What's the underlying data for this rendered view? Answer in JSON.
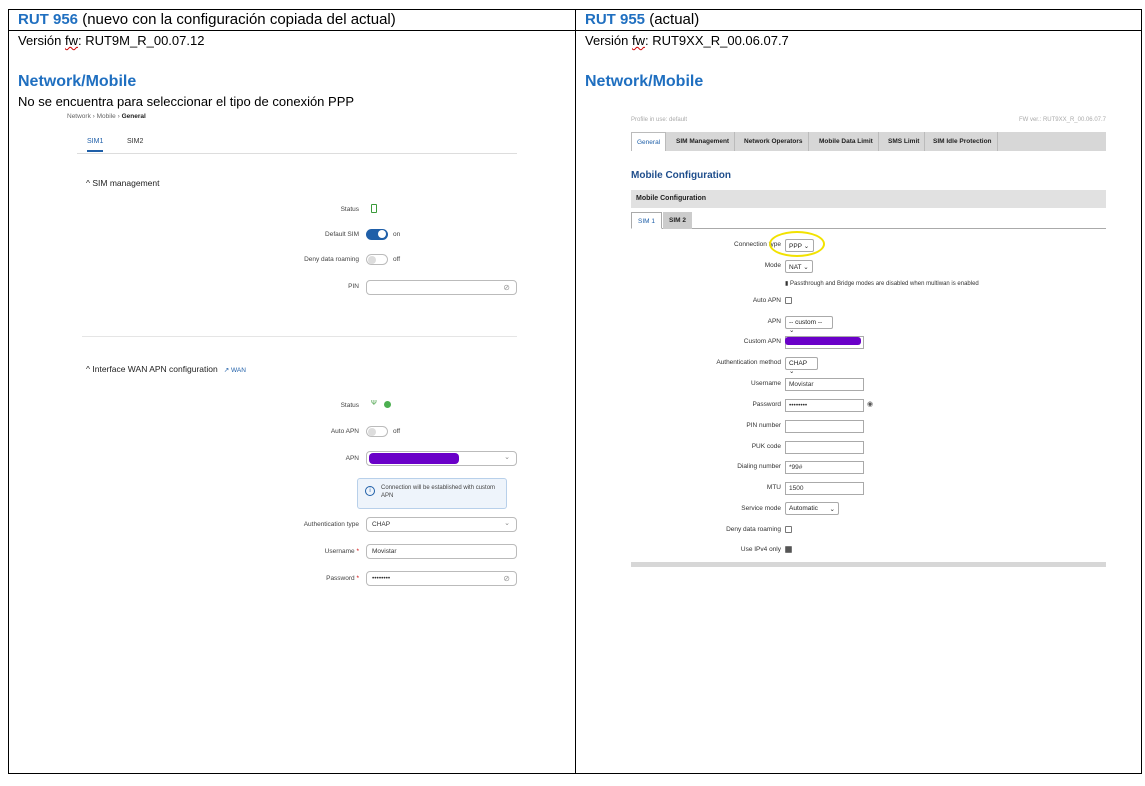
{
  "left": {
    "model": "RUT 956",
    "model_desc": " (nuevo con la configuración copiada del actual)",
    "version_prefix": "Versión ",
    "version_fw": "fw",
    "version_value": ": RUT9M_R_00.07.12",
    "section": "Network/Mobile",
    "note": "No se encuentra para seleccionar el tipo de conexión PPP",
    "shot": {
      "crumb1": "Network",
      "crumb2": "Mobile",
      "crumb3": "General",
      "tab1": "SIM1",
      "tab2": "SIM2",
      "sim_mgmt_title": "SIM management",
      "status_label": "Status",
      "default_sim_label": "Default SIM",
      "default_sim_state": "on",
      "deny_roaming_label": "Deny data roaming",
      "deny_roaming_state": "off",
      "pin_label": "PIN",
      "wan_title": "Interface WAN APN configuration",
      "wan_link": "WAN",
      "status2_label": "Status",
      "auto_apn_label": "Auto APN",
      "auto_apn_state": "off",
      "apn_label": "APN",
      "info_text": "Connection will be established with custom APN",
      "auth_label": "Authentication type",
      "auth_value": "CHAP",
      "username_label": "Username",
      "username_value": "Movistar",
      "password_label": "Password",
      "password_value": "••••••••",
      "required_mark": "*"
    }
  },
  "right": {
    "model": "RUT 955",
    "model_desc": " (actual)",
    "version_prefix": "Versión ",
    "version_fw": "fw",
    "version_value": ": RUT9XX_R_00.06.07.7",
    "section": "Network/Mobile",
    "shot": {
      "profile": "Profile in use: default",
      "fw": "FW ver.: RUT9XX_R_00.06.07.7",
      "tabs": [
        "General",
        "SIM Management",
        "Network Operators",
        "Mobile Data Limit",
        "SMS Limit",
        "SIM Idle Protection"
      ],
      "title": "Mobile Configuration",
      "bar": "Mobile Configuration",
      "sim1": "SIM 1",
      "sim2": "SIM 2",
      "connection_type_label": "Connection type",
      "connection_type_value": "PPP",
      "mode_label": "Mode",
      "mode_value": "NAT",
      "mode_note": "Passthrough and Bridge modes are disabled when multiwan is enabled",
      "auto_apn_label": "Auto APN",
      "apn_label": "APN",
      "apn_value": "-- custom --",
      "custom_apn_label": "Custom APN",
      "auth_label": "Authentication method",
      "auth_value": "CHAP",
      "username_label": "Username",
      "username_value": "Movistar",
      "password_label": "Password",
      "password_value": "••••••••",
      "pin_label": "PIN number",
      "puk_label": "PUK code",
      "dialing_label": "Dialing number",
      "dialing_value": "*99#",
      "mtu_label": "MTU",
      "mtu_value": "1500",
      "service_mode_label": "Service mode",
      "service_mode_value": "Automatic",
      "deny_roaming_label": "Deny data roaming",
      "ipv4_label": "Use IPv4 only"
    }
  },
  "colors": {
    "heading_blue": "#1f6fc0",
    "ui_blue": "#1f5fa8",
    "redaction": "#6a00c8",
    "highlight": "#f2e200"
  }
}
